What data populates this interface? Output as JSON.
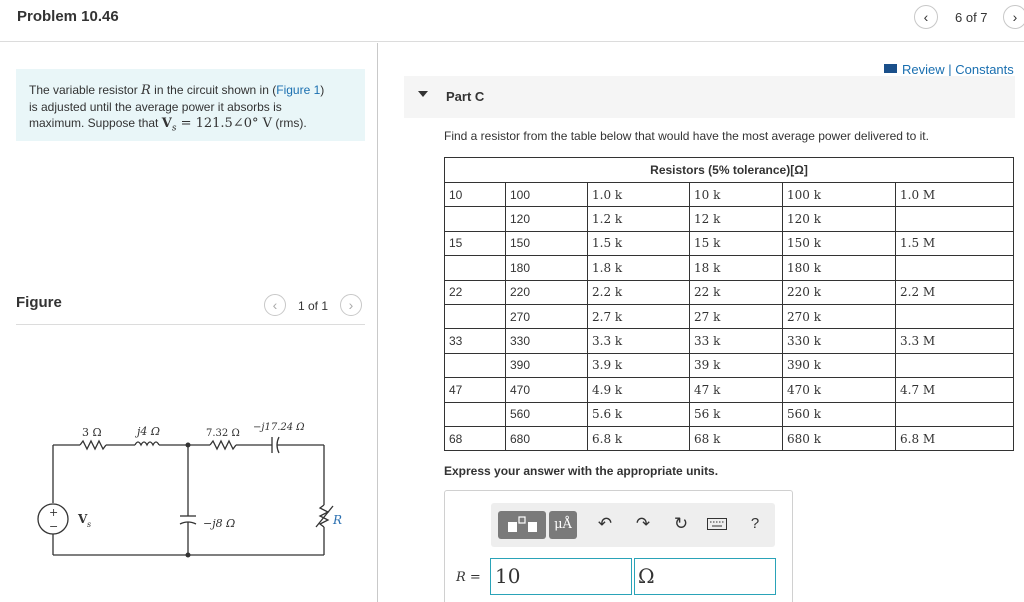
{
  "header": {
    "problem_title": "Problem 10.46",
    "page_indicator": "6 of 7"
  },
  "intro": {
    "line1_pre": "The variable resistor ",
    "r_symbol": "R",
    "line1_mid": " in the circuit shown in (",
    "figure_link": "Figure 1",
    "line1_post": ")",
    "line2": "is adjusted until the average power it absorbs is",
    "line3_pre": "maximum. Suppose that ",
    "vs_eq": "V",
    "vs_sub": "s",
    "vs_value": " = 121.5∠0° V",
    "line3_post": " (rms)."
  },
  "figure": {
    "label": "Figure",
    "counter": "1 of 1",
    "circuit": {
      "r1": "3 Ω",
      "x1": "j4 Ω",
      "r2": "7.32 Ω",
      "x2": "−j17.24 Ω",
      "xc": "−j8 Ω",
      "source": "V",
      "source_sub": "s",
      "load": "R"
    }
  },
  "review": {
    "review": "Review",
    "sep": " | ",
    "constants": "Constants"
  },
  "part": {
    "title": "Part C",
    "prompt": "Find a resistor from the table below that would have the most average power delivered to it."
  },
  "table": {
    "header": "Resistors (5% tolerance)[Ω]",
    "rows": [
      [
        "10",
        "100",
        "1.0 k",
        "10 k",
        "100 k",
        "1.0 M"
      ],
      [
        "",
        "120",
        "1.2 k",
        "12 k",
        "120 k",
        ""
      ],
      [
        "15",
        "150",
        "1.5 k",
        "15 k",
        "150 k",
        "1.5 M"
      ],
      [
        "",
        "180",
        "1.8 k",
        "18 k",
        "180 k",
        ""
      ],
      [
        "22",
        "220",
        "2.2 k",
        "22 k",
        "220 k",
        "2.2 M"
      ],
      [
        "",
        "270",
        "2.7 k",
        "27 k",
        "270 k",
        ""
      ],
      [
        "33",
        "330",
        "3.3 k",
        "33 k",
        "330 k",
        "3.3 M"
      ],
      [
        "",
        "390",
        "3.9 k",
        "39 k",
        "390 k",
        ""
      ],
      [
        "47",
        "470",
        "4.9 k",
        "47 k",
        "470 k",
        "4.7 M"
      ],
      [
        "",
        "560",
        "5.6 k",
        "56 k",
        "560 k",
        ""
      ],
      [
        "68",
        "680",
        "6.8 k",
        "68 k",
        "680 k",
        "6.8 M"
      ]
    ]
  },
  "answer": {
    "express": "Express your answer with the appropriate units.",
    "mu_label": "μÅ",
    "help_label": "?",
    "r_label": "R =",
    "value": "10",
    "units": "Ω"
  }
}
